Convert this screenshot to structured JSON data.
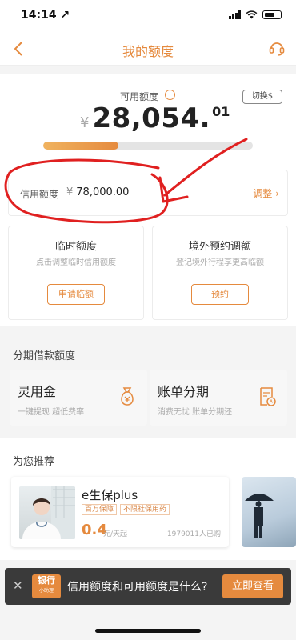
{
  "status_bar": {
    "time": "14:14 ↗"
  },
  "nav": {
    "title": "我的额度",
    "back_icon": "chevron-left-icon",
    "service_icon": "headset-icon"
  },
  "available": {
    "label": "可用额度",
    "info_glyph": "i",
    "switch_label": "切换$",
    "currency": "¥",
    "integer": "28,054.",
    "decimal": "01",
    "used_fraction": 0.36
  },
  "credit": {
    "label": "信用额度",
    "currency": "¥",
    "value": "78,000.00",
    "adjust_label": "调整 ›"
  },
  "temp_limit": {
    "title": "临时额度",
    "desc": "点击调整临时信用额度",
    "button": "申请临额"
  },
  "overseas": {
    "title": "境外预约调额",
    "desc": "登记境外行程享更高临额",
    "button": "预约"
  },
  "installment": {
    "title": "分期借款额度",
    "cards": [
      {
        "title": "灵用金",
        "desc": "一键提现    超低费率",
        "icon": "money-bag-icon"
      },
      {
        "title": "账单分期",
        "desc": "消费无忧    账单分期还",
        "icon": "bill-clock-icon"
      }
    ]
  },
  "recommend": {
    "title": "为您推荐",
    "product": {
      "name": "e生保plus",
      "tags": [
        "百万保障",
        "不限社保用药"
      ],
      "price": "0.4",
      "unit": "元/天起",
      "buyers": "1979011人已购"
    }
  },
  "banner": {
    "close_glyph": "✕",
    "logo_line1": "银行",
    "logo_line2": "小助理",
    "text": "信用额度和可用额度是什么?",
    "button": "立即查看"
  },
  "colors": {
    "accent": "#e58a3e",
    "annotation": "#e02020"
  }
}
